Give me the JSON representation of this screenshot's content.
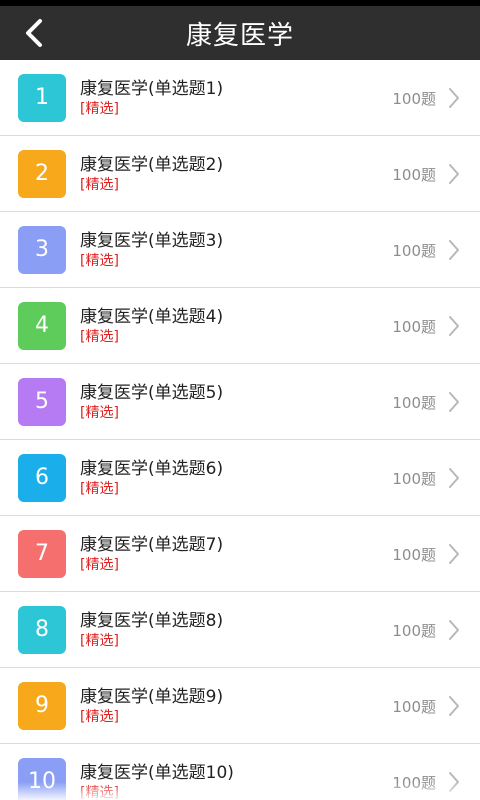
{
  "header": {
    "title": "康复医学",
    "back_icon": "chevron-left-icon"
  },
  "items": [
    {
      "number": "1",
      "title": "康复医学(单选题1)",
      "tag": "[精选]",
      "count": "100题",
      "color": "#2cc6d6"
    },
    {
      "number": "2",
      "title": "康复医学(单选题2)",
      "tag": "[精选]",
      "count": "100题",
      "color": "#f7a81b"
    },
    {
      "number": "3",
      "title": "康复医学(单选题3)",
      "tag": "[精选]",
      "count": "100题",
      "color": "#8a9ef6"
    },
    {
      "number": "4",
      "title": "康复医学(单选题4)",
      "tag": "[精选]",
      "count": "100题",
      "color": "#5dcc5a"
    },
    {
      "number": "5",
      "title": "康复医学(单选题5)",
      "tag": "[精选]",
      "count": "100题",
      "color": "#b67af2"
    },
    {
      "number": "6",
      "title": "康复医学(单选题6)",
      "tag": "[精选]",
      "count": "100题",
      "color": "#1aaeea"
    },
    {
      "number": "7",
      "title": "康复医学(单选题7)",
      "tag": "[精选]",
      "count": "100题",
      "color": "#f56f6f"
    },
    {
      "number": "8",
      "title": "康复医学(单选题8)",
      "tag": "[精选]",
      "count": "100题",
      "color": "#2cc6d6"
    },
    {
      "number": "9",
      "title": "康复医学(单选题9)",
      "tag": "[精选]",
      "count": "100题",
      "color": "#f7a81b"
    },
    {
      "number": "10",
      "title": "康复医学(单选题10)",
      "tag": "[精选]",
      "count": "100题",
      "color": "#8a9ef6"
    }
  ],
  "colors": {
    "topbar": "#2f2f2f",
    "tag": "#e02020",
    "count": "#8c8c8c",
    "divider": "#dcdcdc"
  }
}
